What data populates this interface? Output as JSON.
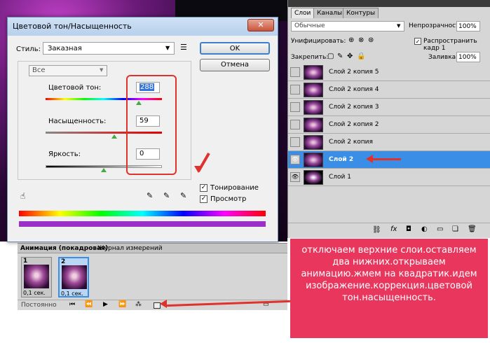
{
  "dialog": {
    "title": "Цветовой тон/Насыщенность",
    "close": "✕",
    "style_label": "Стиль:",
    "style_value": "Заказная",
    "ok": "OK",
    "cancel": "Отмена",
    "channel": "Все",
    "hue_label": "Цветовой тон:",
    "hue_value": "288",
    "sat_label": "Насыщенность:",
    "sat_value": "59",
    "light_label": "Яркость:",
    "light_value": "0",
    "colorize_label": "Тонирование",
    "preview_label": "Просмотр",
    "colorize_checked": "✓",
    "preview_checked": "✓"
  },
  "layers_panel": {
    "tabs": [
      "Слои",
      "Каналы",
      "Контуры"
    ],
    "blend_mode": "Обычные",
    "opacity_label": "Непрозрачность:",
    "opacity_value": "100%",
    "unify_label": "Унифицировать:",
    "propagate_label": "Распространить кадр 1",
    "lock_label": "Закрепить:",
    "fill_label": "Заливка:",
    "fill_value": "100%",
    "layers": [
      {
        "name": "Слой 2 копия 5",
        "visible": false,
        "selected": false
      },
      {
        "name": "Слой 2 копия 4",
        "visible": false,
        "selected": false
      },
      {
        "name": "Слой 2 копия 3",
        "visible": false,
        "selected": false
      },
      {
        "name": "Слой 2 копия 2",
        "visible": false,
        "selected": false
      },
      {
        "name": "Слой 2 копия",
        "visible": false,
        "selected": false
      },
      {
        "name": "Слой 2",
        "visible": true,
        "selected": true
      },
      {
        "name": "Слой 1",
        "visible": true,
        "selected": false
      }
    ]
  },
  "animation_panel": {
    "tab_active": "Анимация (покадровая)",
    "tab_other": "Журнал измерений",
    "frames": [
      {
        "num": "1",
        "delay": "0,1 сек."
      },
      {
        "num": "2",
        "delay": "0,1 сек."
      }
    ],
    "loop": "Постоянно"
  },
  "annotation": {
    "text": "отключаем верхние слои.оставляем два нижних.открываем анимацию.жмем на квадратик.идем изображение.коррекция.цветовой тон.насыщенность."
  },
  "colors": {
    "accent": "#3a8ee6",
    "annotation_bg": "#e8365d",
    "highlight_red": "#e0322d"
  }
}
